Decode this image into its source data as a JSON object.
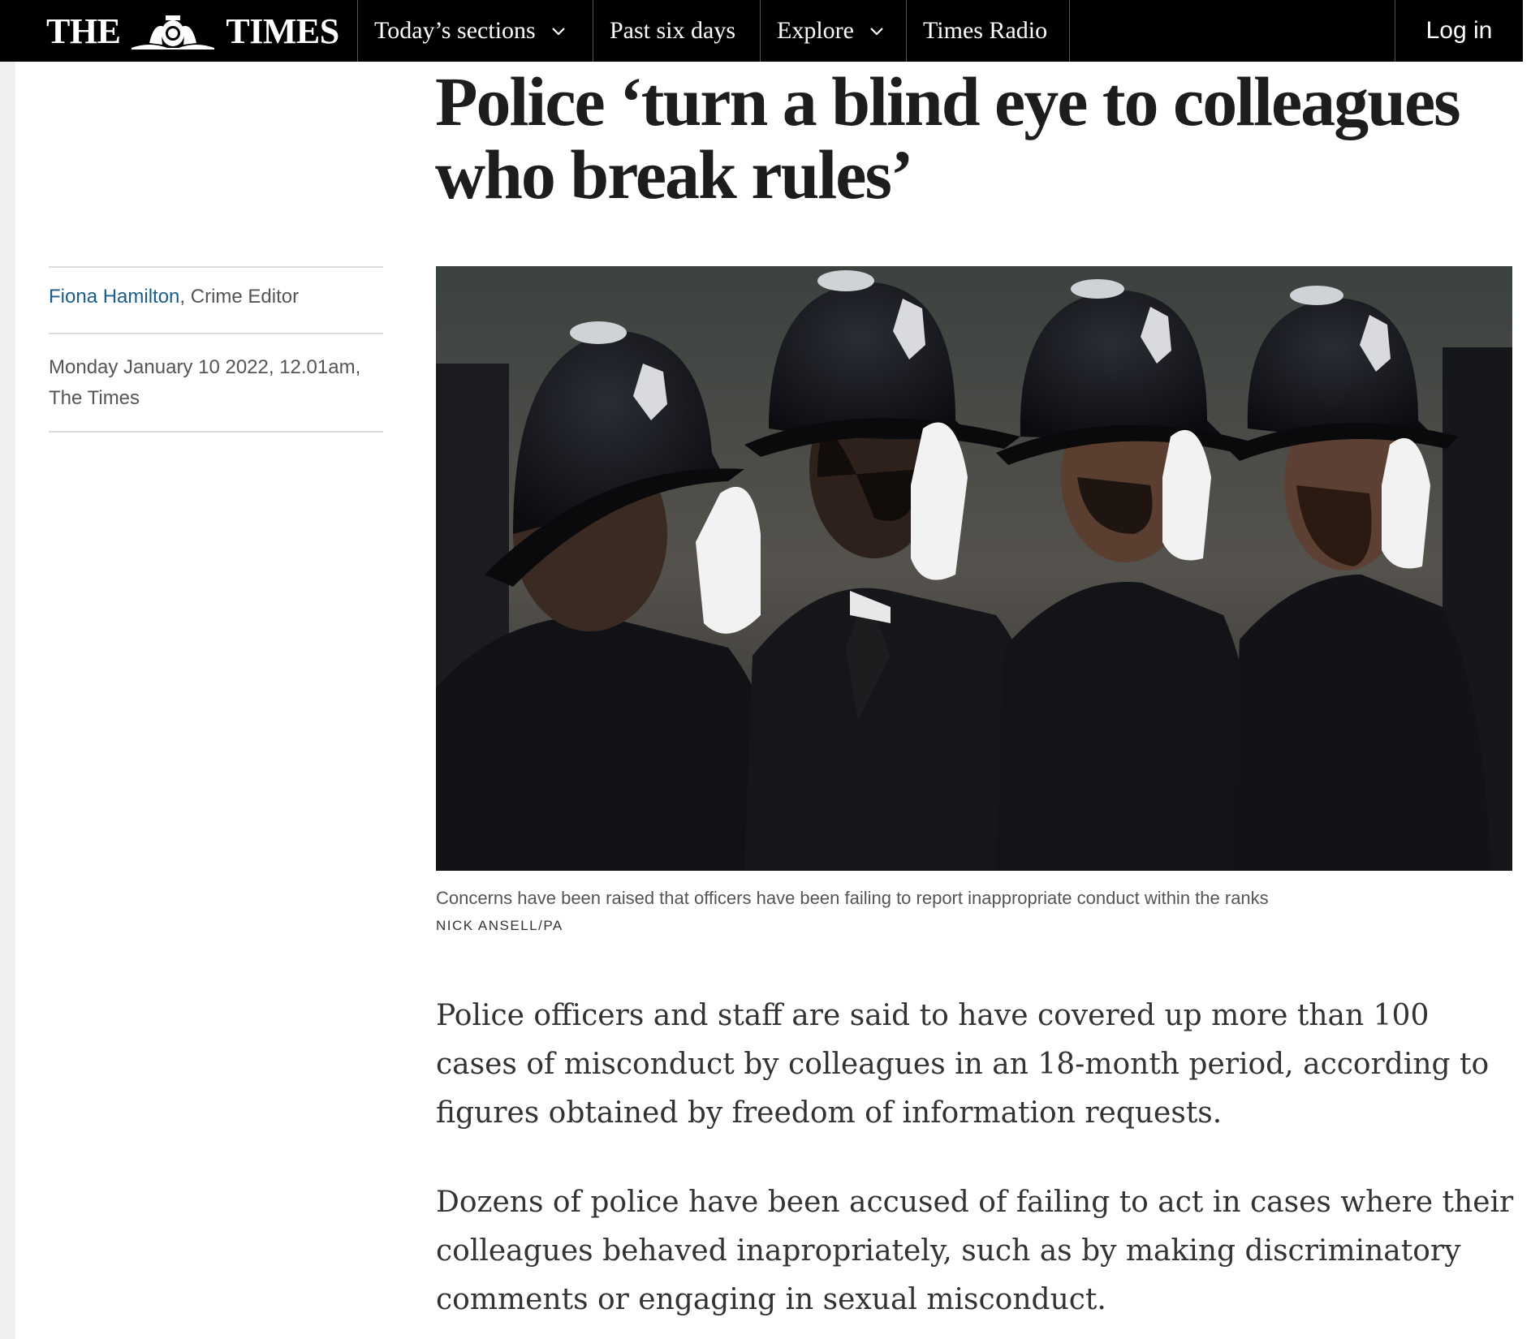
{
  "nav": {
    "logo_left": "THE",
    "logo_right": "TIMES",
    "sections": "Today’s sections",
    "past": "Past six days",
    "explore": "Explore",
    "radio": "Times Radio",
    "login": "Log in"
  },
  "article": {
    "headline": "Police ‘turn a blind eye to colleagues who break rules’",
    "author_name": "Fiona Hamilton",
    "author_role": ", Crime Editor",
    "date": "Monday January 10 2022, 12.01am,",
    "publication": "The Times",
    "image_caption": "Concerns have been raised that officers have been failing to report inappropriate conduct within the ranks",
    "image_credit": "NICK ANSELL/PA",
    "paragraphs": [
      "Police officers and staff are said to have covered up more than 100 cases of misconduct by colleagues in an 18-month period, according to figures obtained by freedom of information requests.",
      "Dozens of police have been accused of failing to act in cases where their colleagues behaved inapropriately, such as by making discriminatory comments or engaging in sexual misconduct."
    ]
  },
  "icons": {
    "sections_chevron": "chevron-down-icon",
    "explore_chevron": "chevron-down-icon",
    "crest": "royal-crest-icon"
  }
}
